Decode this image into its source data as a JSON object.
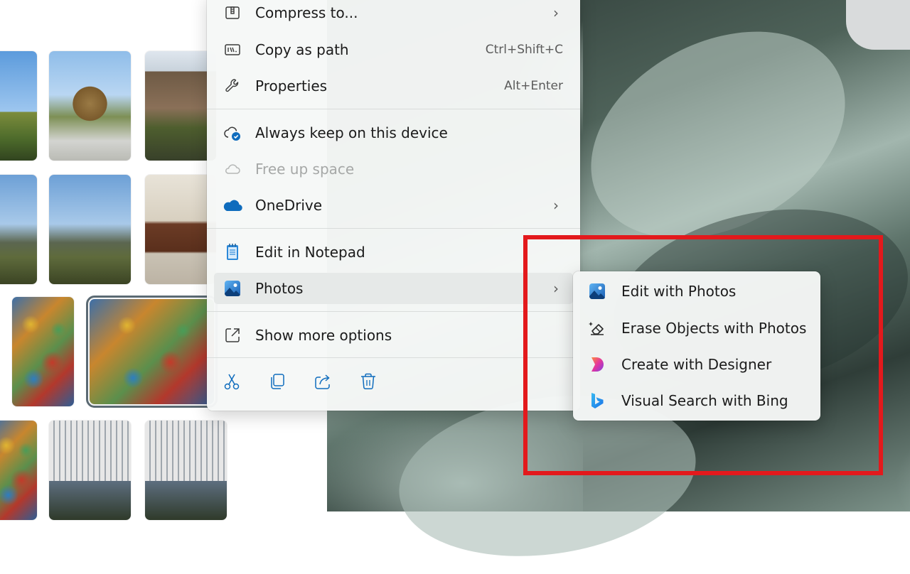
{
  "colors": {
    "accent": "#0f6cbd",
    "annotation": "#e3191c",
    "menu_background": "#f6f8f7",
    "disabled_text": "#a6a8a7"
  },
  "gallery": {
    "thumbnails": [
      {
        "subject": "trees-sky"
      },
      {
        "subject": "autumn-bush"
      },
      {
        "subject": "stone-house"
      },
      {
        "subject": "park-trees"
      },
      {
        "subject": "park-houses"
      },
      {
        "subject": "desk-monitor"
      },
      {
        "subject": "mural"
      },
      {
        "subject": "mural-selected"
      },
      {
        "subject": "mural"
      },
      {
        "subject": "apartment-tower"
      },
      {
        "subject": "apartment-tower"
      }
    ]
  },
  "context_menu": {
    "items": [
      {
        "label": "Compress to...",
        "icon": "compress-icon",
        "has_submenu": true
      },
      {
        "label": "Copy as path",
        "icon": "copy-path-icon",
        "shortcut": "Ctrl+Shift+C"
      },
      {
        "label": "Properties",
        "icon": "wrench-icon",
        "shortcut": "Alt+Enter"
      },
      {
        "label": "Always keep on this device",
        "icon": "cloud-sync-icon"
      },
      {
        "label": "Free up space",
        "icon": "cloud-outline-icon",
        "disabled": true
      },
      {
        "label": "OneDrive",
        "icon": "onedrive-icon",
        "has_submenu": true
      },
      {
        "label": "Edit in Notepad",
        "icon": "notepad-icon"
      },
      {
        "label": "Photos",
        "icon": "photos-icon",
        "has_submenu": true,
        "highlighted": true
      },
      {
        "label": "Show more options",
        "icon": "show-more-icon"
      }
    ],
    "toolbar": [
      {
        "action": "cut",
        "icon": "scissors-icon"
      },
      {
        "action": "copy",
        "icon": "copy-icon"
      },
      {
        "action": "share",
        "icon": "share-icon"
      },
      {
        "action": "delete",
        "icon": "trash-icon"
      }
    ]
  },
  "photos_submenu": {
    "items": [
      {
        "label": "Edit with Photos",
        "icon": "photos-icon"
      },
      {
        "label": "Erase Objects with Photos",
        "icon": "eraser-icon"
      },
      {
        "label": "Create with Designer",
        "icon": "designer-icon"
      },
      {
        "label": "Visual Search with Bing",
        "icon": "bing-icon"
      }
    ]
  }
}
